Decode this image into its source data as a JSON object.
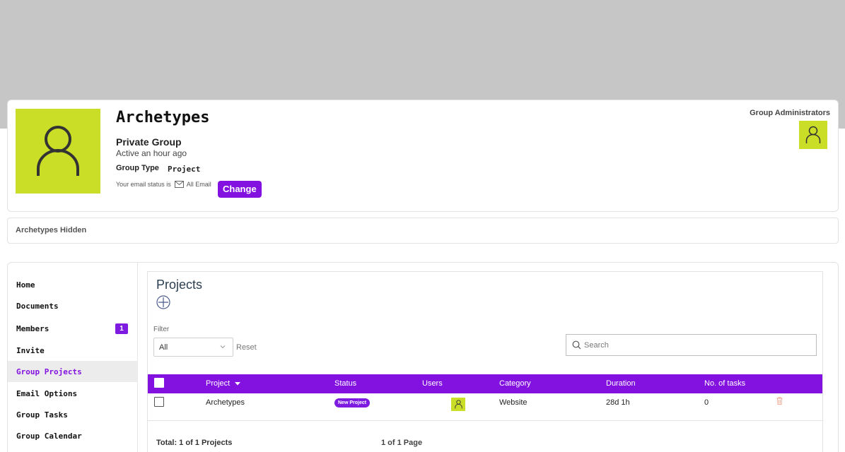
{
  "group": {
    "name": "Archetypes",
    "privacy": "Private Group",
    "activity": "Active an hour ago",
    "type_label": "Group Type",
    "type_value": "Project",
    "email_status_prefix": "Your email status is",
    "email_status_value": "All Email",
    "change_label": "Change",
    "admins_label": "Group Administrators",
    "avatar_color": "#cadd27"
  },
  "notice": {
    "text": "Archetypes Hidden"
  },
  "sidebar": {
    "items": [
      {
        "label": "Home"
      },
      {
        "label": "Documents"
      },
      {
        "label": "Members",
        "badge": "1"
      },
      {
        "label": "Invite"
      },
      {
        "label": "Group Projects",
        "active": true
      },
      {
        "label": "Email Options"
      },
      {
        "label": "Group Tasks"
      },
      {
        "label": "Group Calendar"
      }
    ]
  },
  "projects": {
    "title": "Projects",
    "filter": {
      "label": "Filter",
      "value": "All",
      "reset_label": "Reset"
    },
    "search": {
      "placeholder": "Search"
    },
    "columns": [
      "Project",
      "Status",
      "Users",
      "Category",
      "Duration",
      "No. of tasks"
    ],
    "rows": [
      {
        "project": "Archetypes",
        "status": "New Project",
        "category": "Website",
        "duration": "28d 1h",
        "tasks": "0"
      }
    ],
    "footer": {
      "total": "Total: 1 of 1 Projects",
      "pages": "1 of 1 Page"
    }
  },
  "colors": {
    "accent": "#8312e0",
    "avatar": "#cadd27",
    "cover": "#c6c6c6"
  }
}
